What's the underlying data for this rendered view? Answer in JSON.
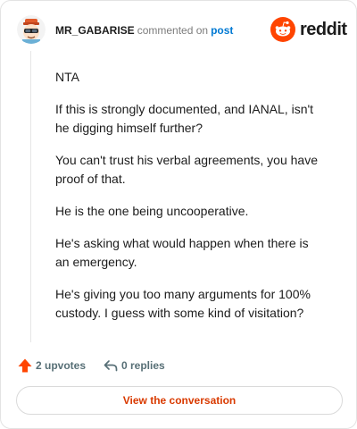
{
  "header": {
    "username": "MR_GABARISE",
    "action_text": "commented on",
    "link_text": "post",
    "avatar_icon": "snoo-avatar-icon",
    "brand_icon": "reddit-logo-icon",
    "brand_word": "reddit"
  },
  "comment": {
    "paragraphs": [
      "NTA",
      "If this is strongly documented, and IANAL, isn't he digging himself further?",
      "You can't trust his verbal agreements, you have proof of that.",
      "He is the one being uncooperative.",
      "He's asking what would happen when there is an emergency.",
      "He's giving you too many arguments for 100% custody. I guess with some kind of visitation?"
    ]
  },
  "actions": {
    "upvotes_label": "2 upvotes",
    "replies_label": "0 replies",
    "upvote_icon": "upvote-arrow-icon",
    "reply_icon": "reply-arrow-icon"
  },
  "cta": {
    "label": "View the conversation"
  },
  "colors": {
    "brand_orange": "#ff4500",
    "link_blue": "#0079d3",
    "cta_text": "#d93a00",
    "muted": "#576f76"
  }
}
